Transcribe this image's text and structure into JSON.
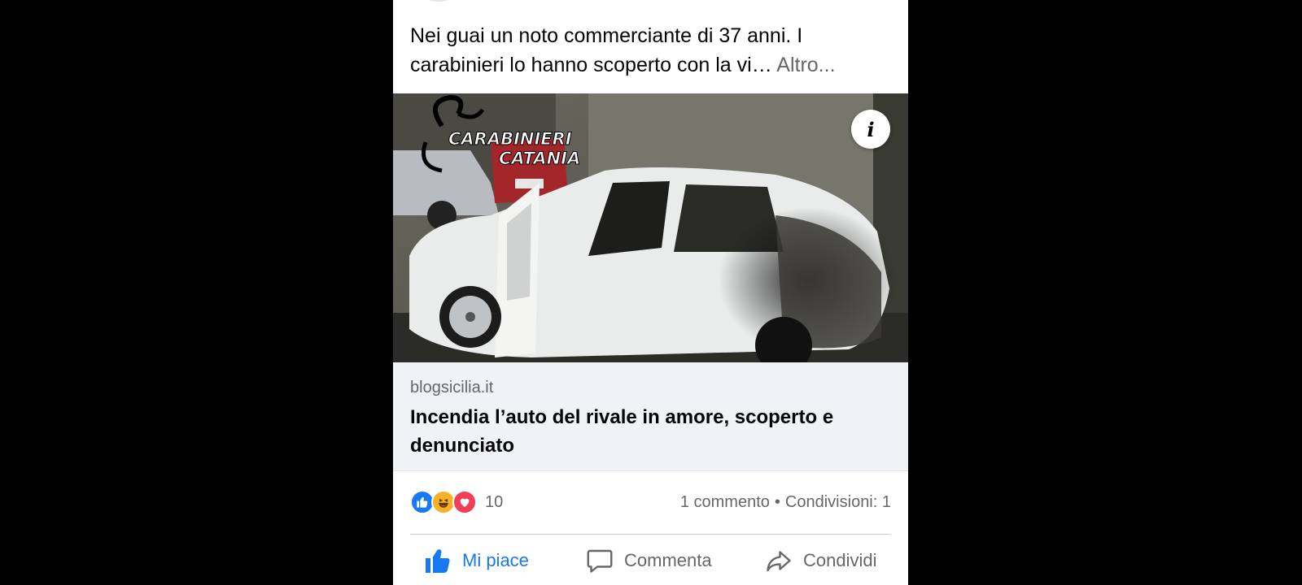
{
  "post": {
    "caption_text": "Nei guai un noto commerciante di 37 anni. I carabinieri lo hanno scoperto con la vi…",
    "caption_more": "Altro...",
    "image": {
      "watermark_line1": "CARABINIERI",
      "watermark_line2": "CATANIA",
      "info_icon": "i"
    },
    "link": {
      "domain": "blogsicilia.it",
      "title": "Incendia l’auto del rivale in amore, scoperto e denunciato"
    },
    "stats": {
      "reaction_icons": [
        "like-icon",
        "haha-icon",
        "love-icon"
      ],
      "reaction_count": "10",
      "comments": "1 commento",
      "separator": "•",
      "shares": "Condivisioni: 1"
    },
    "actions": {
      "like_label": "Mi piace",
      "comment_label": "Commenta",
      "share_label": "Condividi"
    },
    "colors": {
      "accent": "#1877f2",
      "muted": "#65676b",
      "card_bg": "#f0f2f5"
    }
  }
}
